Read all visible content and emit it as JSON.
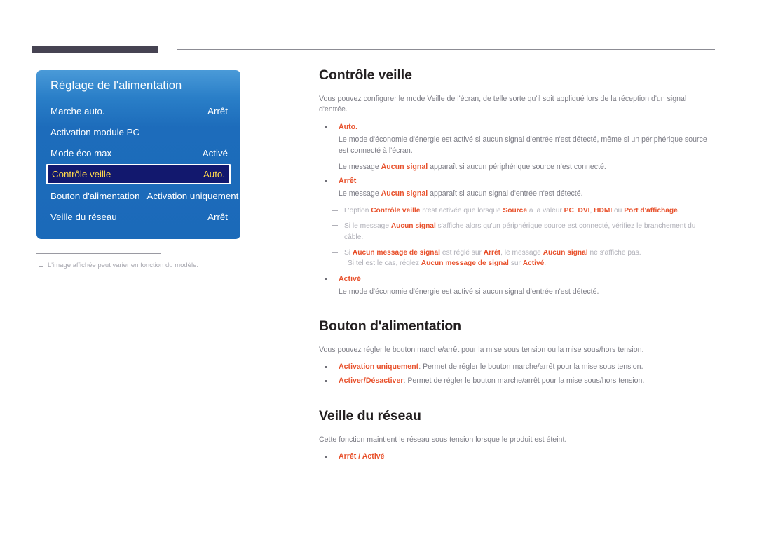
{
  "page": {
    "top_rule": "decorative-bar"
  },
  "osd": {
    "title": "Réglage de l'alimentation",
    "rows": [
      {
        "label": "Marche auto.",
        "value": "Arrêt",
        "selected": false,
        "wide": false
      },
      {
        "label": "Activation module PC",
        "value": "",
        "selected": false,
        "wide": false
      },
      {
        "label": "Mode éco max",
        "value": "Activé",
        "selected": false,
        "wide": false
      },
      {
        "label": "Contrôle veille",
        "value": "Auto.",
        "selected": true,
        "wide": false
      },
      {
        "label": "Bouton d'alimentation",
        "value": "Activation uniquement",
        "selected": false,
        "wide": true
      },
      {
        "label": "Veille du réseau",
        "value": "Arrêt",
        "selected": false,
        "wide": false
      }
    ],
    "footnote": "L'image affichée peut varier en fonction du modèle."
  },
  "sections": [
    {
      "id": "controle-veille",
      "title": "Contrôle veille",
      "intro": "Vous pouvez configurer le mode Veille de l'écran, de telle sorte qu'il soit appliqué lors de la réception d'un signal d'entrée.",
      "bullets": [
        {
          "head": "Auto.",
          "bodies": [
            "Le mode d'économie d'énergie est activé si aucun signal d'entrée n'est détecté, même si un périphérique source est connecté à l'écran.",
            "Le message Aucun signal apparaît si aucun périphérique source n'est connecté."
          ]
        },
        {
          "head": "Arrêt",
          "bodies": [
            "Le message Aucun signal apparaît si aucun signal d'entrée n'est détecté."
          ]
        },
        {
          "head": "Activé",
          "bodies": [
            "Le mode d'économie d'énergie est activé si aucun signal d'entrée n'est détecté."
          ]
        }
      ],
      "subnotes": [
        "L'option Contrôle veille n'est activée que lorsque Source a la valeur PC, DVI, HDMI ou Port d'affichage.",
        "Si le message Aucun signal s'affiche alors qu'un périphérique source est connecté, vérifiez le branchement du câble.",
        "Si Aucun message de signal est réglé sur Arrêt, le message Aucun signal ne s'affiche pas. Si tel est le cas, réglez Aucun message de signal sur Activé."
      ]
    },
    {
      "id": "bouton-alimentation",
      "title": "Bouton d'alimentation",
      "intro": "Vous pouvez régler le bouton marche/arrêt pour la mise sous tension ou la mise sous/hors tension.",
      "inline_bullets": [
        {
          "term": "Activation uniquement",
          "rest": ": Permet de régler le bouton marche/arrêt pour la mise sous tension."
        },
        {
          "term": "Activer/Désactiver",
          "rest": ": Permet de régler le bouton marche/arrêt pour la mise sous/hors tension."
        }
      ]
    },
    {
      "id": "veille-du-reseau",
      "title": "Veille du réseau",
      "intro": "Cette fonction maintient le réseau sous tension lorsque le produit est éteint.",
      "inline_bullets": [
        {
          "term": "Arrêt / Activé",
          "rest": ""
        }
      ]
    }
  ],
  "colors": {
    "accent": "#e8512c",
    "osd_blue": "#1d6cbb",
    "osd_selected_bg": "#12186e",
    "osd_selected_text": "#ffd84d",
    "body_text": "#7d7d86",
    "heading_text": "#231f20",
    "rule_dark": "#464352"
  }
}
